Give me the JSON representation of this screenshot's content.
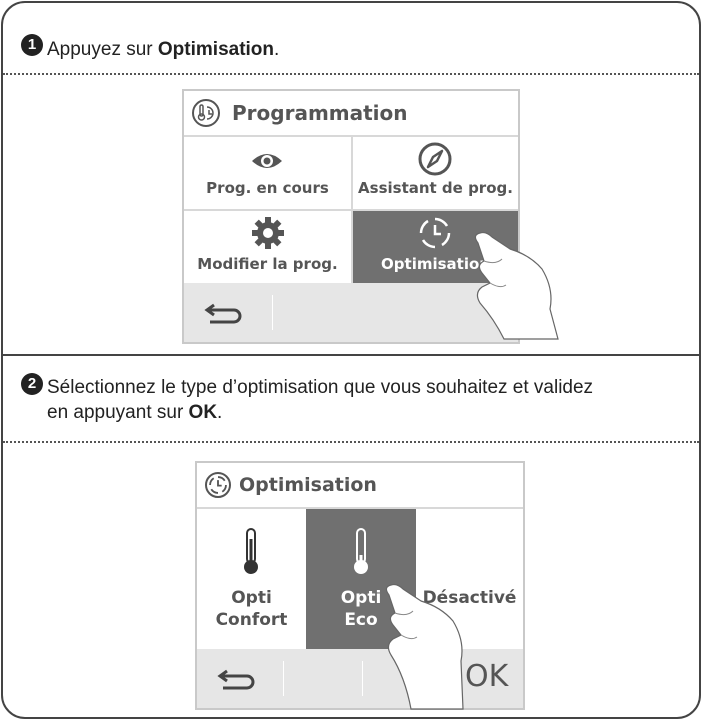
{
  "step1": {
    "number": "1",
    "text_before": "Appuyez sur ",
    "text_bold": "Optimisation",
    "text_after": ".",
    "screen": {
      "title": "Programmation",
      "title_icon": "program-clock-icon",
      "tiles": [
        {
          "label": "Prog. en cours",
          "icon": "eye-icon",
          "selected": false
        },
        {
          "label": "Assistant de prog.",
          "icon": "compass-icon",
          "selected": false
        },
        {
          "label": "Modifier la prog.",
          "icon": "gear-icon",
          "selected": false
        },
        {
          "label": "Optimisation",
          "icon": "optimisation-clock-icon",
          "selected": true
        }
      ],
      "back_icon": "back-arrow-icon"
    }
  },
  "step2": {
    "number": "2",
    "text_line1": "Sélectionnez le type d’optimisation que vous souhaitez et validez",
    "text_line2_before": "en appuyant sur ",
    "text_line2_bold": "OK",
    "text_line2_after": ".",
    "screen": {
      "title": "Optimisation",
      "title_icon": "optimisation-clock-icon",
      "options": [
        {
          "line1": "Opti",
          "line2": "Confort",
          "icon": "thermometer-full-icon",
          "selected": false
        },
        {
          "line1": "Opti",
          "line2": "Eco",
          "icon": "thermometer-low-icon",
          "selected": true
        },
        {
          "line1": "Désactivé",
          "line2": "",
          "icon": "",
          "selected": false
        }
      ],
      "back_icon": "back-arrow-icon",
      "ok_label": "OK"
    }
  },
  "colors": {
    "selected": "#707070",
    "footer": "#e6e6e6",
    "text": "#555555"
  }
}
